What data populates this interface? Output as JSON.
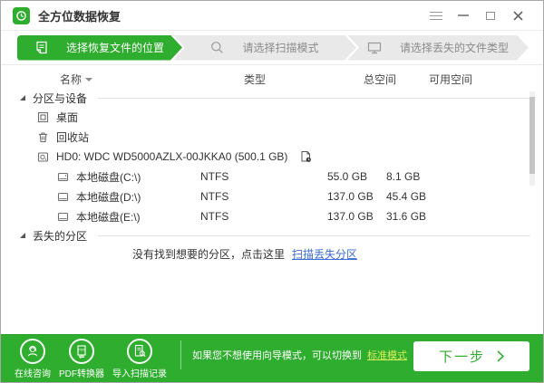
{
  "titlebar": {
    "title": "全方位数据恢复"
  },
  "steps": [
    {
      "label": "选择恢复文件的位置",
      "icon": "document-icon",
      "active": true
    },
    {
      "label": "请选择扫描模式",
      "icon": "search-icon",
      "active": false
    },
    {
      "label": "请选择丢失的文件类型",
      "icon": "monitor-icon",
      "active": false
    }
  ],
  "table": {
    "headers": {
      "name": "名称",
      "type": "类型",
      "total": "总空间",
      "free": "可用空间"
    }
  },
  "list": {
    "section_devices": "分区与设备",
    "section_lost": "丢失的分区",
    "rows": {
      "desktop": {
        "name": "桌面"
      },
      "recycle": {
        "name": "回收站"
      },
      "hd0": {
        "name": "HD0: WDC WD5000AZLX-00JKKA0 (500.1 GB)"
      },
      "disks": [
        {
          "name": "本地磁盘(C:\\)",
          "type": "NTFS",
          "total": "55.0 GB",
          "free": "8.1 GB"
        },
        {
          "name": "本地磁盘(D:\\)",
          "type": "NTFS",
          "total": "137.0 GB",
          "free": "45.4 GB"
        },
        {
          "name": "本地磁盘(E:\\)",
          "type": "NTFS",
          "total": "137.0 GB",
          "free": "31.6 GB"
        }
      ]
    },
    "lost_hint": "没有找到想要的分区，点击这里",
    "lost_link": "扫描丢失分区"
  },
  "footer": {
    "tools": [
      {
        "label": "在线咨询",
        "icon": "headset-person-icon"
      },
      {
        "label": "PDF转换器",
        "icon": "pdf-converter-icon"
      },
      {
        "label": "导入扫描记录",
        "icon": "import-scan-icon"
      }
    ],
    "hint_prefix": "如果您不想使用向导模式，可以切换到",
    "hint_link": "标准模式",
    "next_label": "下一步"
  },
  "colors": {
    "accent": "#2fad2f",
    "link_blue": "#3a6ad4",
    "link_yellow": "#d9ee5a"
  }
}
